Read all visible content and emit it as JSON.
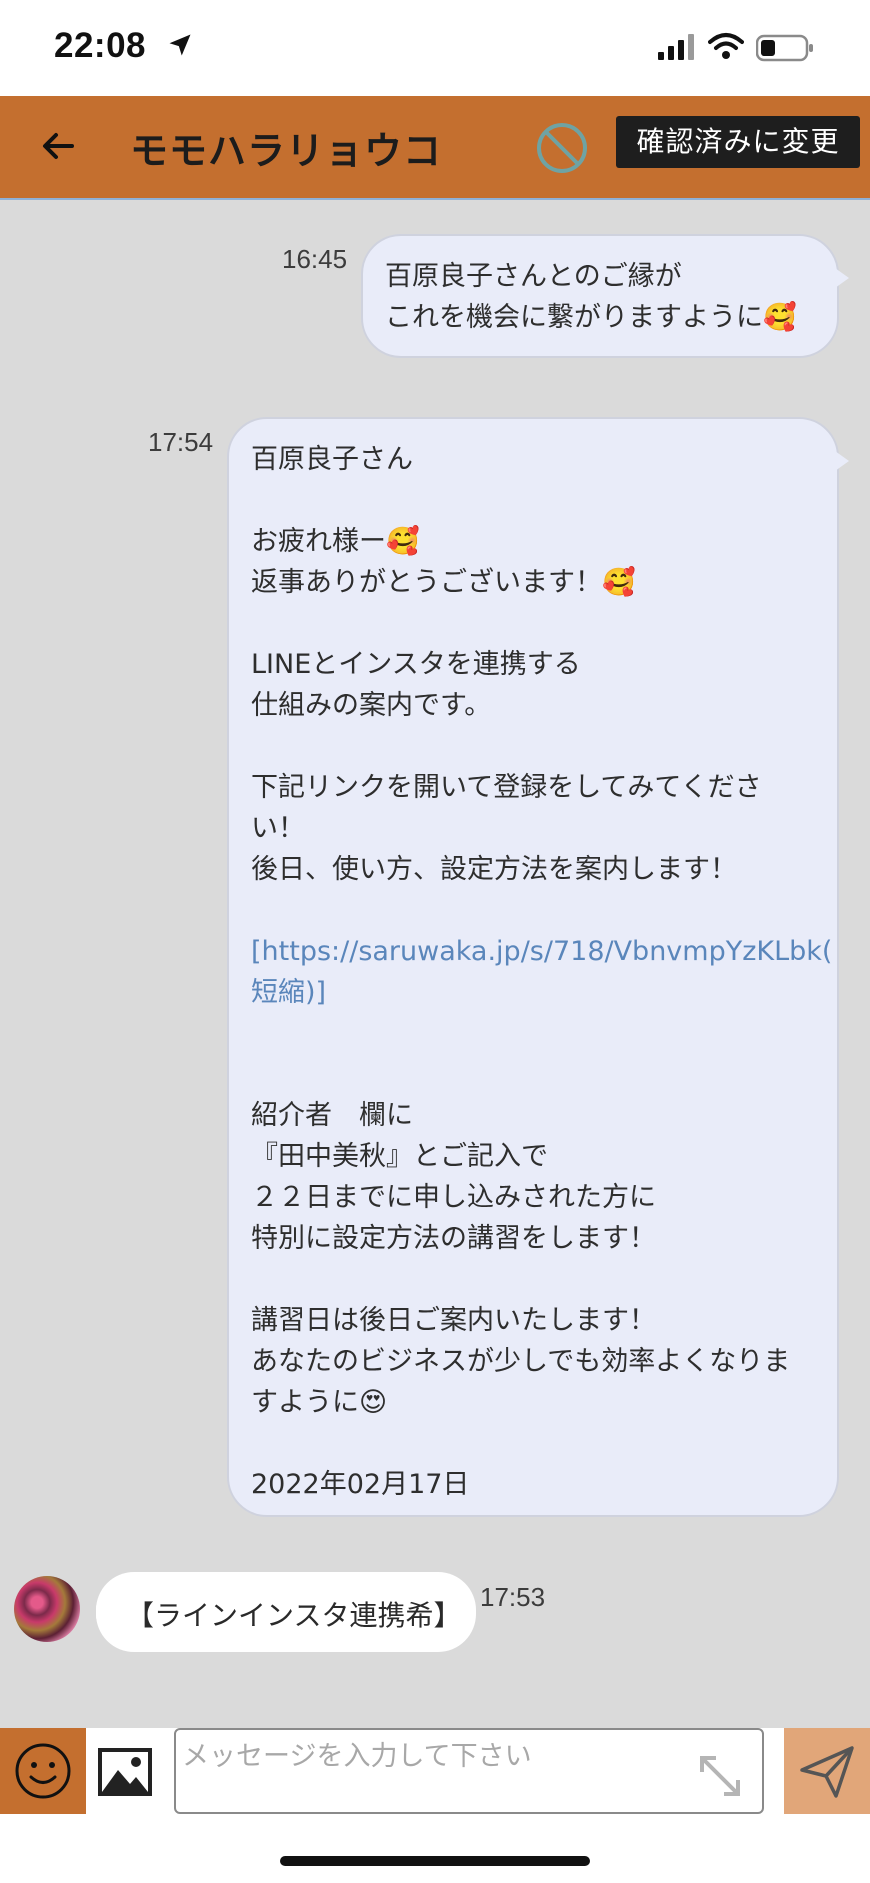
{
  "status_bar": {
    "time": "22:08"
  },
  "header": {
    "title": "モモハラリョウコ",
    "confirm_label": "確認済みに変更"
  },
  "messages": [
    {
      "time": "16:45",
      "lines": [
        "百原良子さんとのご縁が",
        "これを機会に繋がりますように🥰"
      ]
    },
    {
      "time": "17:54",
      "lines": [
        "百原良子さん",
        "",
        "お疲れ様ー🥰",
        "返事ありがとうございます！🥰",
        "",
        "LINEとインスタを連携する",
        "仕組みの案内です。",
        "",
        "下記リンクを開いて登録をしてみてくださ",
        "い！",
        "後日、使い方、設定方法を案内します！",
        "",
        "[https://saruwaka.jp/s/718/VbnvmpYzKLbk(",
        "短縮)]",
        "",
        "",
        "紹介者　欄に",
        "『田中美秋』とご記入で",
        "２２日までに申し込みされた方に",
        "特別に設定方法の講習をします！",
        "",
        "講習日は後日ご案内いたします！",
        "あなたのビジネスが少しでも効率よくなりま",
        "すように😍",
        "",
        "2022年02月17日"
      ]
    }
  ],
  "incoming": {
    "text": "【ラインインスタ連携希】",
    "time": "17:53"
  },
  "input": {
    "placeholder": "メッセージを入力して下さい"
  },
  "colors": {
    "accent": "#c46f2f",
    "chat_bg": "#dadada",
    "bubble": "#e9ecf9",
    "link": "#5a86bb"
  },
  "icons": [
    "location-arrow-icon",
    "signal-icon",
    "wifi-icon",
    "battery-icon",
    "back-arrow-icon",
    "block-icon",
    "smiley-icon",
    "image-icon",
    "expand-icon",
    "send-icon"
  ]
}
